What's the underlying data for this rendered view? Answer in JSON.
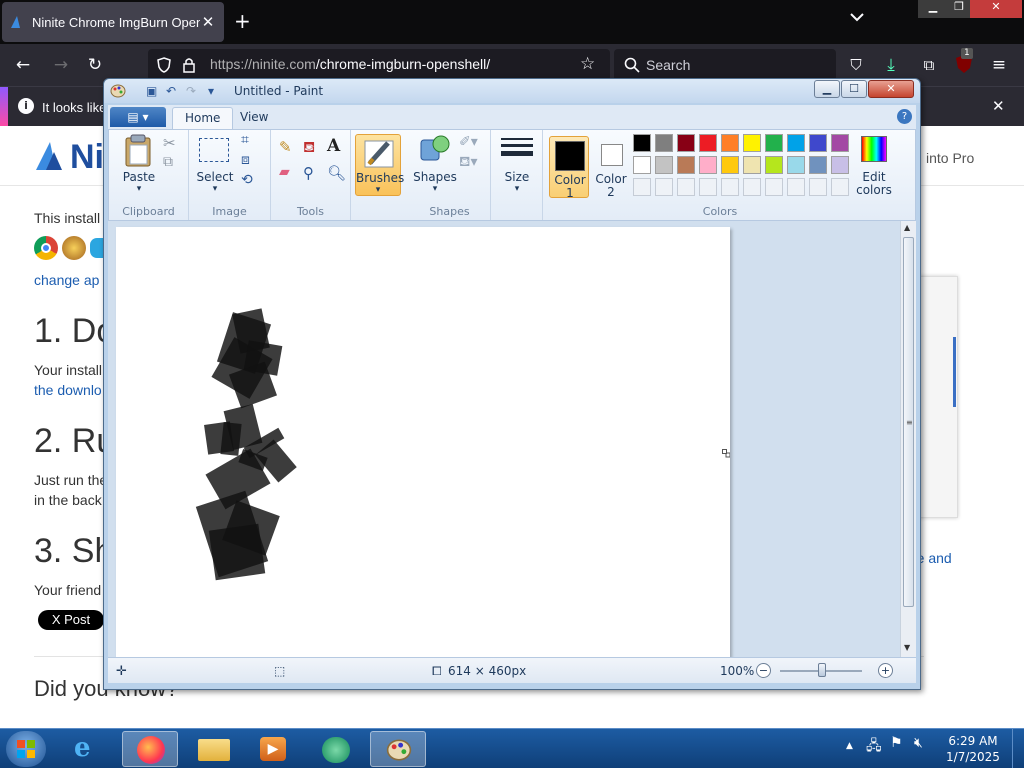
{
  "browser": {
    "tab_title": "Ninite Chrome ImgBurn Open",
    "tab_close": "✕",
    "new_tab": "+",
    "url_host": "https://ninite.com",
    "url_path": "/chrome-imgburn-openshell/",
    "search_placeholder": "Search",
    "notification_text": "It looks like",
    "extension_badge": "1"
  },
  "webpage": {
    "logo_text": "Ni",
    "into_pro": "into Pro",
    "intro_text": "This install",
    "change_link": "change ap",
    "step1_heading": "1. Do",
    "step1_text": "Your install",
    "step1_link": "the downlo",
    "step2_heading": "2. Ru",
    "step2_text1": "Just run the",
    "step2_text2": "in the back",
    "step3_heading": "3. Sh",
    "step3_text": "Your friend",
    "share_link": "re and",
    "xpost": "X Post",
    "did_you_know": "Did you know?"
  },
  "paint": {
    "title": "Untitled - Paint",
    "tabs": {
      "home": "Home",
      "view": "View"
    },
    "groups": {
      "clipboard": "Clipboard",
      "image": "Image",
      "tools": "Tools",
      "shapes": "Shapes",
      "colors": "Colors"
    },
    "buttons": {
      "paste": "Paste",
      "select": "Select",
      "brushes": "Brushes",
      "shapes": "Shapes",
      "size": "Size",
      "color1_line1": "Color",
      "color1_line2": "1",
      "color2_line1": "Color",
      "color2_line2": "2",
      "edit_colors_line1": "Edit",
      "edit_colors_line2": "colors"
    },
    "palette": [
      "#000000",
      "#7f7f7f",
      "#880015",
      "#ed1c24",
      "#ff7f27",
      "#fff200",
      "#22b14c",
      "#00a2e8",
      "#3f48cc",
      "#a349a4",
      "#ffffff",
      "#c3c3c3",
      "#b97a57",
      "#ffaec9",
      "#ffc90e",
      "#efe4b0",
      "#b5e61d",
      "#99d9ea",
      "#7092be",
      "#c8bfe7"
    ],
    "color1": "#000000",
    "color2": "#ffffff",
    "status": {
      "dimensions": "614 × 460px",
      "zoom": "100%"
    }
  },
  "taskbar": {
    "time": "6:29 AM",
    "date": "1/7/2025"
  }
}
